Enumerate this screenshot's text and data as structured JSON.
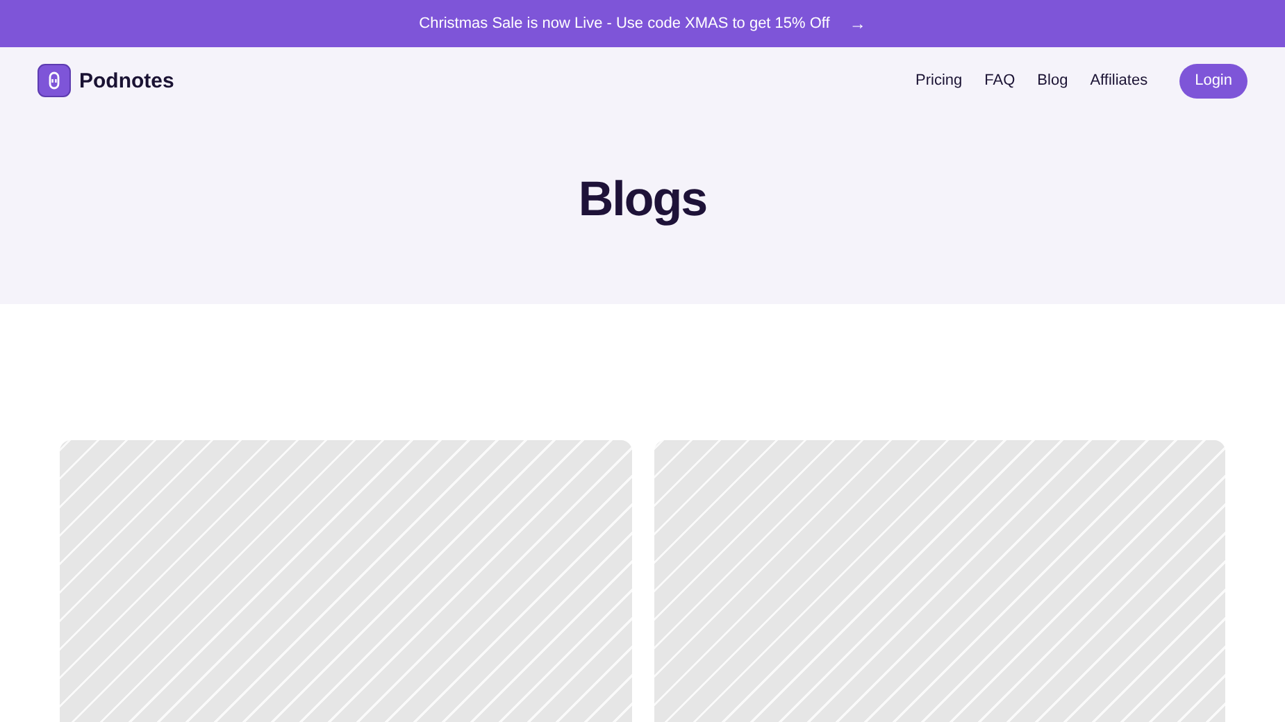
{
  "banner": {
    "text": "Christmas Sale is now Live - Use code XMAS to get 15% Off",
    "arrow": "→"
  },
  "header": {
    "brand": "Podnotes",
    "nav": [
      "Pricing",
      "FAQ",
      "Blog",
      "Affiliates"
    ],
    "login": "Login"
  },
  "hero": {
    "title": "Blogs"
  },
  "posts": [
    {
      "kind": "placeholder"
    },
    {
      "kind": "placeholder"
    }
  ]
}
